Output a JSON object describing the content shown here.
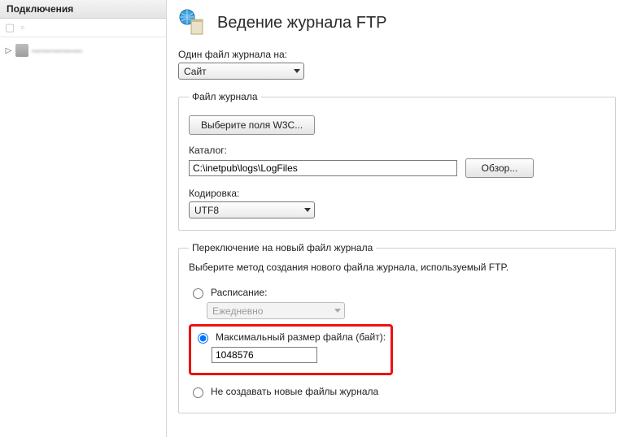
{
  "sidebar": {
    "title": "Подключения",
    "node": "—————"
  },
  "page": {
    "title": "Ведение журнала FTP"
  },
  "oneLogPer": {
    "label": "Один файл журнала на:",
    "value": "Сайт"
  },
  "logFile": {
    "legend": "Файл журнала",
    "selectFieldsBtn": "Выберите поля W3C...",
    "catalogLabel": "Каталог:",
    "catalogValue": "C:\\inetpub\\logs\\LogFiles",
    "browseBtn": "Обзор...",
    "encodingLabel": "Кодировка:",
    "encodingValue": "UTF8"
  },
  "rollover": {
    "legend": "Переключение на новый файл журнала",
    "hint": "Выберите метод создания нового файла журнала, используемый FTP.",
    "scheduleLabel": "Расписание:",
    "scheduleValue": "Ежедневно",
    "maxSizeLabel": "Максимальный размер файла (байт):",
    "maxSizeValue": "1048576",
    "noNewLabel": "Не создавать новые файлы журнала"
  }
}
